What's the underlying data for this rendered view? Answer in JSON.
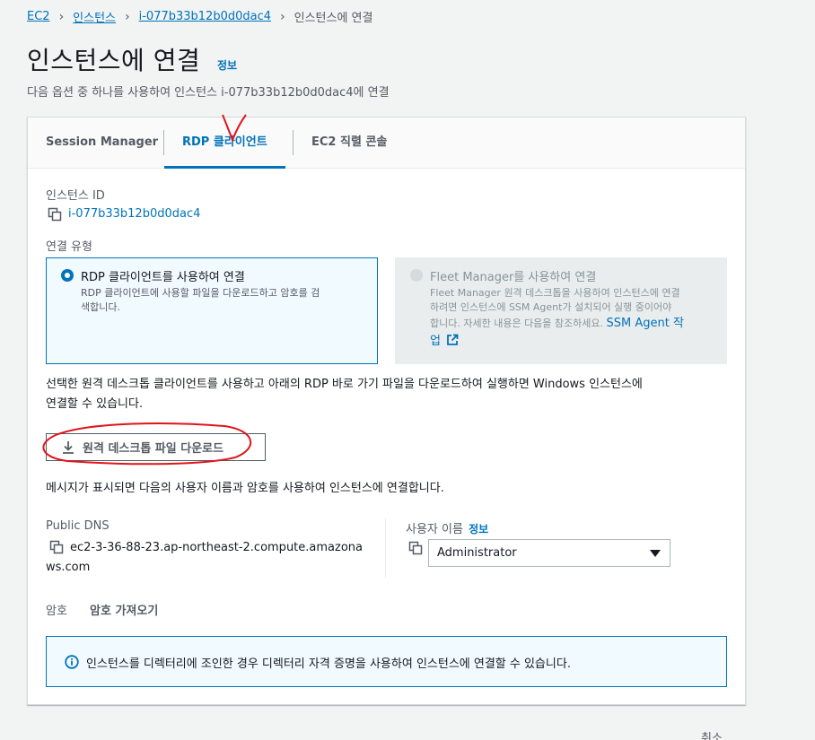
{
  "breadcrumb": {
    "items": [
      "EC2",
      "인스턴스",
      "i-077b33b12b0d0dac4"
    ],
    "current": "인스턴스에 연결"
  },
  "page": {
    "title": "인스턴스에 연결",
    "info_link": "정보",
    "description": "다음 옵션 중 하나를 사용하여 인스턴스 i-077b33b12b0d0dac4에 연결"
  },
  "tabs": [
    {
      "label": "Session Manager"
    },
    {
      "label": "RDP 클라이언트",
      "active": true
    },
    {
      "label": "EC2 직렬 콘솔"
    }
  ],
  "instance": {
    "id_label": "인스턴스 ID",
    "id_value": "i-077b33b12b0d0dac4"
  },
  "connection_type": {
    "label": "연결 유형",
    "options": [
      {
        "title": "RDP 클라이언트를 사용하여 연결",
        "desc_line1": "RDP 클라이언트에 사용할 파일을 다운로드하고 암호를 검",
        "desc_line2": "색합니다.",
        "selected": true
      },
      {
        "title": "Fleet Manager를 사용하여 연결",
        "desc_line1": "Fleet Manager 원격 데스크톱을 사용하여 인스턴스에 연결",
        "desc_line2": "하려면 인스턴스에 SSM Agent가 설치되어 실행 중이어야",
        "desc_line3": "합니다. 자세한 내용은 다음을 참조하세요.",
        "link_part1": "SSM Agent 작",
        "link_part2": "업",
        "selected": false,
        "disabled": true
      }
    ]
  },
  "instructions": {
    "line1": "선택한 원격 데스크톱 클라이언트를 사용하고 아래의 RDP 바로 가기 파일을 다운로드하여 실행하면 Windows 인스턴스에",
    "line2": "연결할 수 있습니다."
  },
  "download_button": "원격 데스크톱 파일 다운로드",
  "message_text": "메시지가 표시되면 다음의 사용자 이름과 암호를 사용하여 인스턴스에 연결합니다.",
  "public_dns": {
    "label": "Public DNS",
    "value_line1": "ec2-3-36-88-23.ap-northeast-2.compute.amazona",
    "value_line2": "ws.com"
  },
  "username": {
    "label": "사용자 이름",
    "info_link": "정보",
    "selected": "Administrator"
  },
  "password": {
    "label": "암호",
    "action": "암호 가져오기"
  },
  "info_alert": "인스턴스를 디렉터리에 조인한 경우 디렉터리 자격 증명을 사용하여 인스턴스에 연결할 수 있습니다.",
  "footer": {
    "cancel": "취소"
  },
  "colors": {
    "link": "#0073bb",
    "annotation": "#e0141b",
    "background": "#f2f3f3"
  }
}
